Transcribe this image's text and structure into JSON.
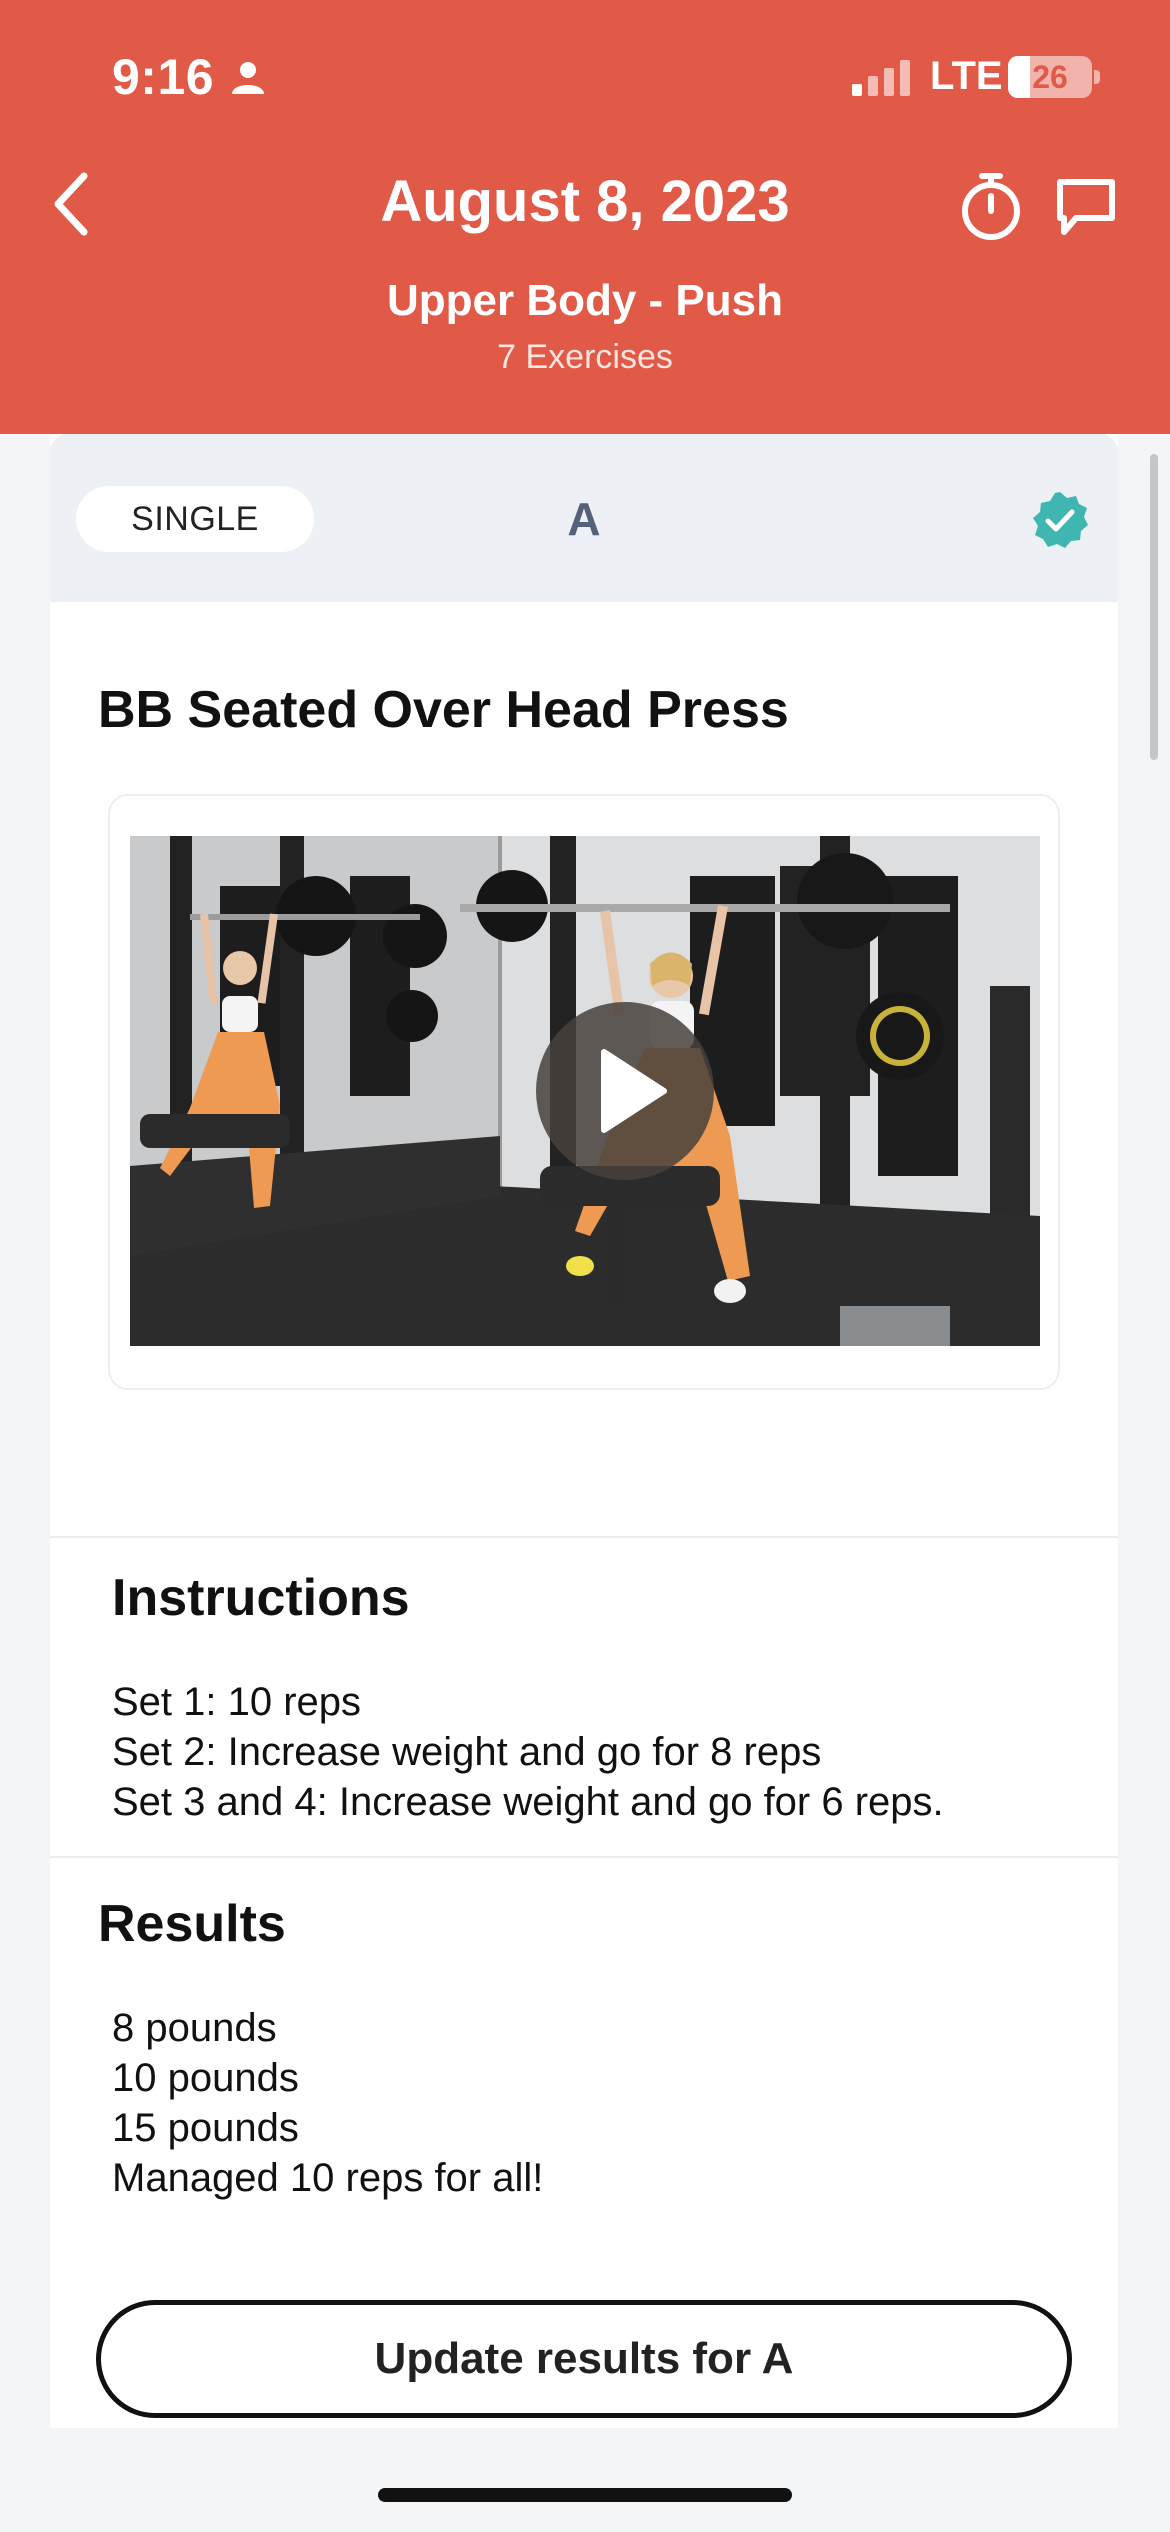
{
  "status_bar": {
    "time": "9:16",
    "network": "LTE",
    "battery": "26",
    "battery_level": 0.26
  },
  "header": {
    "title": "August 8, 2023",
    "workout_name": "Upper Body - Push",
    "exercise_count": "7 Exercises",
    "background_color": "#e05a47"
  },
  "exercise_card": {
    "type_label": "SINGLE",
    "group_letter": "A",
    "completed": true,
    "check_color": "#3fb6b2",
    "title": "BB Seated Over Head Press",
    "video": {
      "icon": "play-icon"
    },
    "instructions": {
      "heading": "Instructions",
      "lines": [
        "Set 1: 10 reps",
        "Set 2: Increase weight and go for 8 reps",
        "Set 3 and 4: Increase weight and go for 6 reps."
      ]
    },
    "results": {
      "heading": "Results",
      "lines": [
        "8 pounds",
        "10 pounds",
        "15 pounds",
        "Managed 10 reps for all!"
      ]
    },
    "update_button_label": "Update results for A"
  },
  "icons": {
    "back": "chevron-left-icon",
    "timer": "stopwatch-icon",
    "chat": "chat-bubble-icon",
    "completed": "check-badge-icon"
  }
}
